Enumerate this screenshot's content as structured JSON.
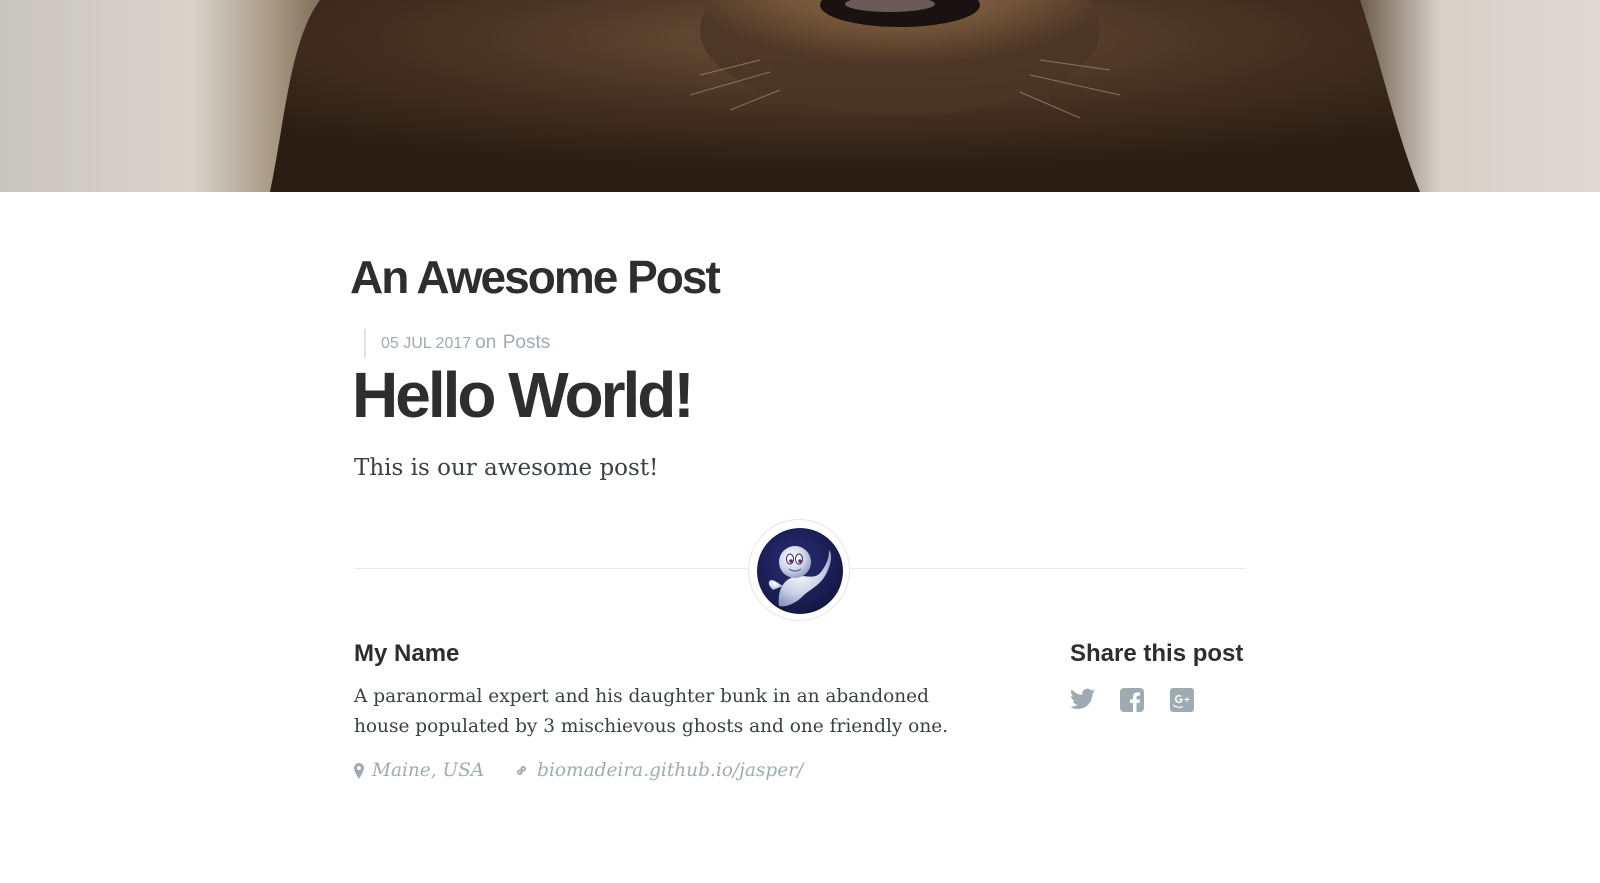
{
  "post_header": {
    "title": "An Awesome Post"
  },
  "post_meta": {
    "date": "05 JUL 2017",
    "on": "on",
    "tag": "Posts"
  },
  "post_body": {
    "title": "Hello World!",
    "text": "This is our awesome post!"
  },
  "author": {
    "name": "My Name",
    "bio": "A paranormal expert and his daughter bunk in an abandoned house populated by 3 mischievous ghosts and one friendly one.",
    "location": "Maine, USA",
    "website": "biomadeira.github.io/jasper/"
  },
  "share": {
    "title": "Share this post",
    "icons": [
      "twitter-icon",
      "facebook-icon",
      "google-plus-icon"
    ]
  },
  "colors": {
    "heading": "#2e2e2e",
    "text": "#3a4145",
    "muted": "#9eabb3",
    "rule": "#ebebeb"
  }
}
